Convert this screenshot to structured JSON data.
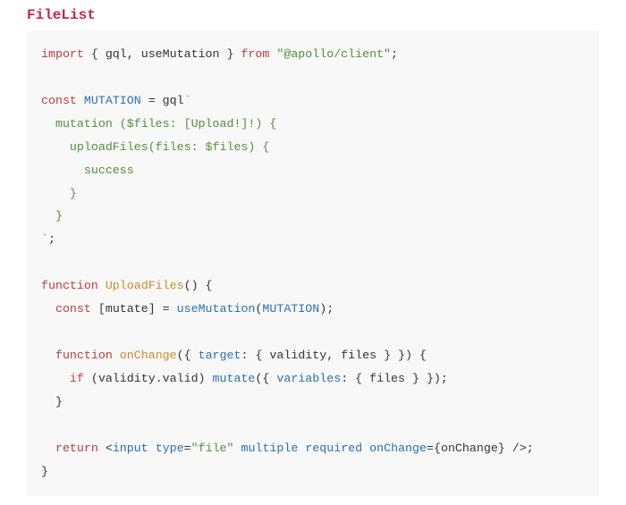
{
  "title": "FileList",
  "code": {
    "l1a": "import",
    "l1b": " { gql, useMutation } ",
    "l1c": "from",
    "l1d": " ",
    "l1e": "\"@apollo/client\"",
    "l1f": ";",
    "l3a": "const",
    "l3b": " ",
    "l3c": "MUTATION",
    "l3d": " = gql",
    "l3e": "`",
    "l4": "  mutation ($files: [Upload!]!) {",
    "l5": "    uploadFiles(files: $files) {",
    "l6": "      success",
    "l7": "    }",
    "l8": "  }",
    "l9a": "`",
    "l9b": ";",
    "l11a": "function",
    "l11b": " ",
    "l11c": "UploadFiles",
    "l11d": "() {",
    "l12a": "  ",
    "l12b": "const",
    "l12c": " [mutate] = ",
    "l12d": "useMutation",
    "l12e": "(",
    "l12f": "MUTATION",
    "l12g": ");",
    "l14a": "  ",
    "l14b": "function",
    "l14c": " ",
    "l14d": "onChange",
    "l14e": "({ ",
    "l14f": "target",
    "l14g": ": { validity, files } }) {",
    "l15a": "    ",
    "l15b": "if",
    "l15c": " (validity.valid) ",
    "l15d": "mutate",
    "l15e": "({ ",
    "l15f": "variables",
    "l15g": ": { files } });",
    "l16": "  }",
    "l18a": "  ",
    "l18b": "return",
    "l18c": " <",
    "l18d": "input",
    "l18e": " ",
    "l18f": "type",
    "l18g": "=",
    "l18h": "\"file\"",
    "l18i": " ",
    "l18j": "multiple",
    "l18k": " ",
    "l18l": "required",
    "l18m": " ",
    "l18n": "onChange",
    "l18o": "={onChange} />;",
    "l19": "}"
  }
}
